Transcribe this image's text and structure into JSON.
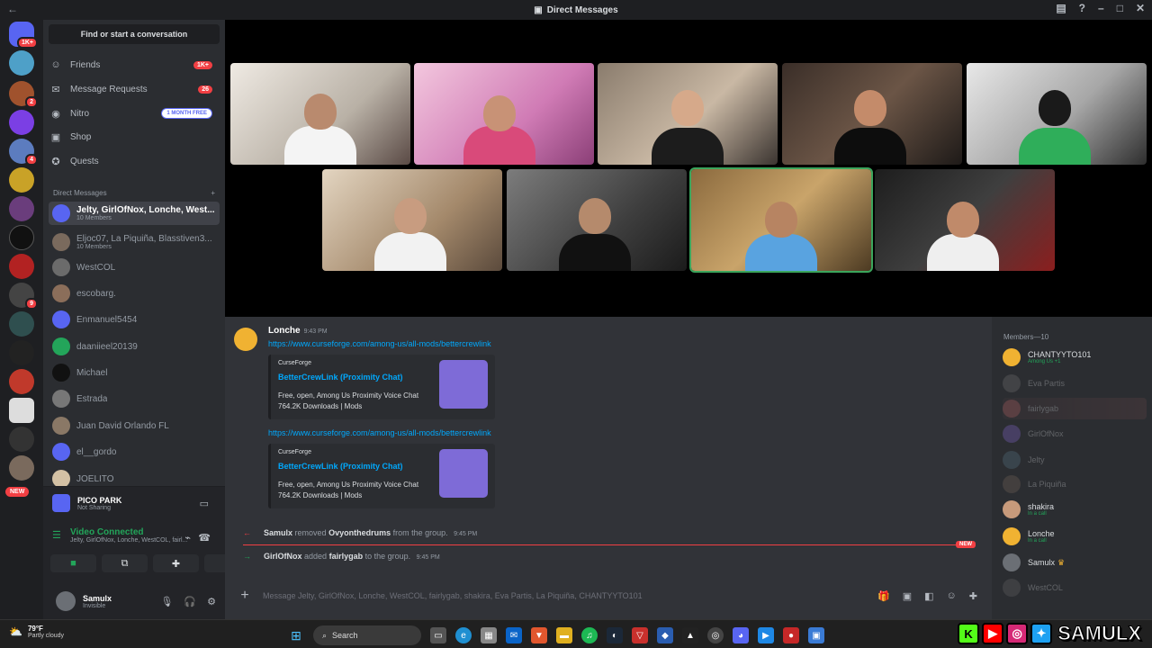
{
  "window": {
    "title": "Direct Messages"
  },
  "guilds": {
    "top_badge": "1K+",
    "badges": [
      "2",
      "4",
      "9"
    ],
    "new_label": "NEW"
  },
  "sidebar": {
    "find_placeholder": "Find or start a conversation",
    "nav": [
      {
        "label": "Friends",
        "badge": "1K+"
      },
      {
        "label": "Message Requests",
        "badge": "26"
      },
      {
        "label": "Nitro",
        "badge": "1 MONTH FREE"
      },
      {
        "label": "Shop"
      },
      {
        "label": "Quests"
      }
    ],
    "dm_header": "Direct Messages",
    "dms": [
      {
        "name": "Jelty, GirlOfNox, Lonche, West...",
        "sub": "10 Members",
        "color": "#5865f2"
      },
      {
        "name": "Eljoc07, La Piquiña, Blasstiven3...",
        "sub": "10 Members",
        "color": "#7a6a5d"
      },
      {
        "name": "WestCOL",
        "color": "#6b6b6b"
      },
      {
        "name": "escobarg.",
        "color": "#8b6e5a"
      },
      {
        "name": "Enmanuel5454",
        "color": "#5865f2"
      },
      {
        "name": "daaniieel20139",
        "color": "#23a55a"
      },
      {
        "name": "Michael",
        "color": "#111111"
      },
      {
        "name": "Estrada",
        "color": "#777777"
      },
      {
        "name": "Juan David Orlando FL",
        "color": "#8a7866"
      },
      {
        "name": "el__gordo",
        "color": "#5865f2"
      },
      {
        "name": "JOELITO",
        "color": "#d4c1a4"
      }
    ]
  },
  "voice": {
    "activity_title": "PICO PARK",
    "activity_sub": "Not Sharing",
    "status": "Video Connected",
    "channel": "Jelty, GirlOfNox, Lonche, WestCOL, fairl..."
  },
  "user": {
    "name": "Samulx",
    "status": "Invisible"
  },
  "chat": {
    "author": "Lonche",
    "time": "9:43 PM",
    "link": "https://www.curseforge.com/among-us/all-mods/bettercrewlink",
    "embed": {
      "provider": "CurseForge",
      "title": "BetterCrewLink (Proximity Chat)",
      "desc1": "Free, open, Among Us Proximity Voice Chat",
      "desc2": "764.2K Downloads | Mods"
    },
    "sys1": {
      "actor": "Samulx",
      "action": "removed",
      "target": "Ovyonthedrums",
      "tail": "from the group.",
      "time": "9:45 PM"
    },
    "sys2": {
      "actor": "GirlOfNox",
      "action": "added",
      "target": "fairlygab",
      "tail": "to the group.",
      "time": "9:45 PM"
    },
    "new_label": "NEW",
    "composer_placeholder": "Message Jelty, GirlOfNox, Lonche, WestCOL, fairlygab, shakira, Eva Partis, La Piquiña, CHANTYYTO101"
  },
  "members": {
    "header": "Members—10",
    "list": [
      {
        "name": "CHANTYYTO101",
        "status": "Among Us +1",
        "color": "#f0b232",
        "off": false
      },
      {
        "name": "Eva Partis",
        "color": "#777",
        "off": true
      },
      {
        "name": "fairlygab",
        "color": "#c76b6b",
        "off": true,
        "hl": true
      },
      {
        "name": "GirlOfNox",
        "color": "#8a6bd7",
        "off": true
      },
      {
        "name": "Jelty",
        "color": "#5a7a8a",
        "off": true
      },
      {
        "name": "La Piquiña",
        "color": "#7a6a5d",
        "off": true
      },
      {
        "name": "shakira",
        "status": "In a call",
        "color": "#c79a7b",
        "off": false
      },
      {
        "name": "Lonche",
        "status": "In a call",
        "color": "#f0b232",
        "off": false
      },
      {
        "name": "Samulx",
        "status": "",
        "color": "#6b6f75",
        "off": false,
        "crown": "♛"
      },
      {
        "name": "WestCOL",
        "color": "#6b6b6b",
        "off": true
      }
    ]
  },
  "taskbar": {
    "temp": "79°F",
    "weather": "Partly cloudy",
    "search": "Search"
  },
  "overlay": {
    "handle": "SAMULX"
  }
}
